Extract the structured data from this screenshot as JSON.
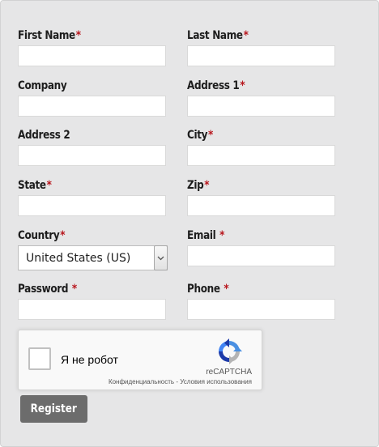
{
  "form": {
    "required_marker": "*",
    "fields": {
      "first_name": {
        "label": "First Name",
        "value": ""
      },
      "last_name": {
        "label": "Last Name",
        "value": ""
      },
      "company": {
        "label": "Company",
        "value": ""
      },
      "address1": {
        "label": "Address 1",
        "value": ""
      },
      "address2": {
        "label": "Address 2",
        "value": ""
      },
      "city": {
        "label": "City",
        "value": ""
      },
      "state": {
        "label": "State",
        "value": ""
      },
      "zip": {
        "label": "Zip",
        "value": ""
      },
      "country": {
        "label": "Country",
        "value": "United States (US)"
      },
      "email": {
        "label": "Email",
        "value": ""
      },
      "password": {
        "label": "Password",
        "value": ""
      },
      "phone": {
        "label": "Phone",
        "value": ""
      }
    },
    "submit_label": "Register"
  },
  "recaptcha": {
    "checkbox_label": "Я не робот",
    "brand": "reCAPTCHA",
    "privacy": "Конфиденциальность",
    "separator": " - ",
    "terms": "Условия использования",
    "icon": "recaptcha-logo-icon"
  },
  "colors": {
    "panel_bg": "#e6e6e7",
    "required": "#b8161d",
    "button_bg": "#6c6c6c"
  }
}
